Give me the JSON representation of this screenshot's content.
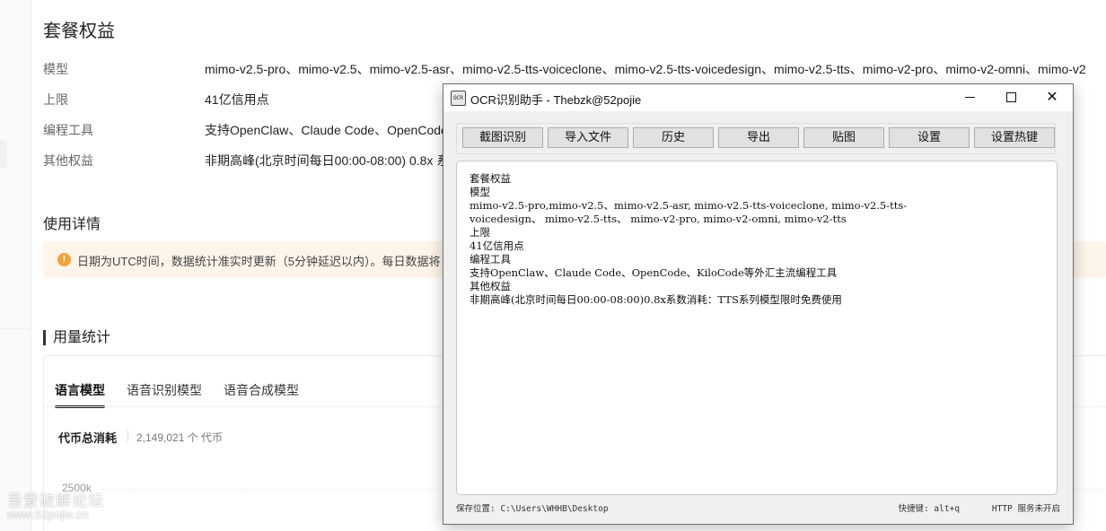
{
  "plan": {
    "title": "套餐权益",
    "rows": [
      {
        "key": "模型",
        "value": "mimo-v2.5-pro、mimo-v2.5、mimo-v2.5-asr、mimo-v2.5-tts-voiceclone、mimo-v2.5-tts-voicedesign、mimo-v2.5-tts、mimo-v2-pro、mimo-v2-omni、mimo-v2"
      },
      {
        "key": "上限",
        "value": "41亿信用点"
      },
      {
        "key": "编程工具",
        "value": "支持OpenClaw、Claude Code、OpenCode"
      },
      {
        "key": "其他权益",
        "value": "非期高峰(北京时间每日00:00-08:00) 0.8x 系"
      }
    ]
  },
  "usage_details": {
    "title": "使用详情",
    "notice": "日期为UTC时间，数据统计准实时更新（5分钟延迟以内）。每日数据将"
  },
  "usage_stats": {
    "title": "用量统计",
    "tabs": [
      "语言模型",
      "语音识别模型",
      "语音合成模型"
    ],
    "active_tab": "语言模型",
    "metric_label": "代币总消耗",
    "metric_value": "2,149,021 个 代币",
    "axis_tick": "2500k"
  },
  "watermark": {
    "text": "吾爱破解论坛",
    "url": "www.52pojie.cn"
  },
  "ocr_window": {
    "title": "OCR识别助手 - Thebzk@52pojie",
    "icon_text": "OCR",
    "toolbar": [
      "截图识别",
      "导入文件",
      "历史",
      "导出",
      "贴图",
      "设置",
      "设置热键"
    ],
    "text_lines": [
      "套餐权益",
      "模型",
      "mimo-v2.5-pro,mimo-v2.5、mimo-v2.5-asr, mimo-v2.5-tts-voiceclone, mimo-v2.5-tts-",
      "voicedesign、 mimo-v2.5-tts、 mimo-v2-pro, mimo-v2-omni, mimo-v2-tts",
      "上限",
      "41亿信用点",
      "编程工具",
      "支持OpenClaw、Claude Code、OpenCode、KiloCode等外汇主流编程工具",
      "其他权益",
      "非期高峰(北京时间每日00:00-08:00)0.8x系数消耗：TTS系列模型限时免费使用"
    ],
    "status": {
      "save_path": "保存位置: C:\\Users\\WHHB\\Desktop",
      "hotkey": "快捷键: alt+q",
      "http": "HTTP 服务未开启"
    }
  }
}
